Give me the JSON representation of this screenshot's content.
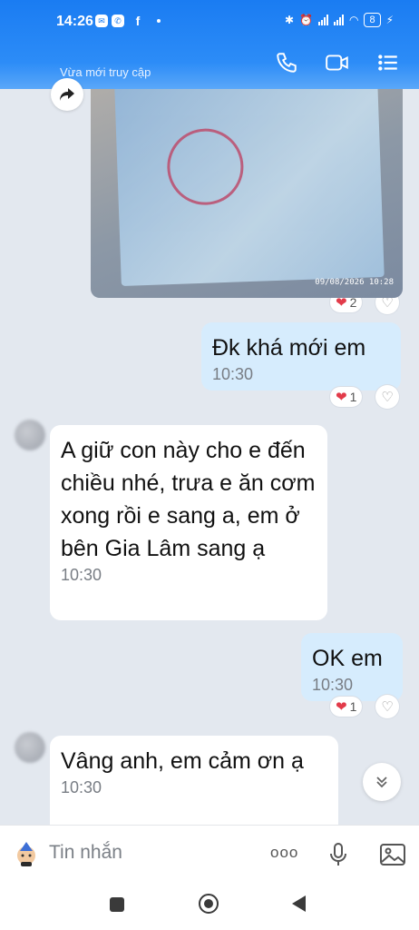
{
  "status_bar": {
    "time": "14:26",
    "battery": "8"
  },
  "header": {
    "subtitle": "Vừa mới truy cập"
  },
  "photo": {
    "timestamp": "09/08/2026 10:28"
  },
  "messages": [
    {
      "direction": "in",
      "type": "image",
      "reaction_count": "2"
    },
    {
      "direction": "out",
      "text": "Đk khá mới em",
      "time": "10:30",
      "reaction_count": "1"
    },
    {
      "direction": "in",
      "text": "A giữ con này cho e đến chiều nhé, trưa e ăn cơm xong rồi e sang a, em ở bên Gia Lâm sang ạ",
      "time": "10:30"
    },
    {
      "direction": "out",
      "text": "OK em",
      "time": "10:30",
      "reaction_count": "1"
    },
    {
      "direction": "in",
      "text": "Vâng anh, em cảm ơn ạ",
      "time": "10:30"
    }
  ],
  "composer": {
    "placeholder": "Tin nhắn",
    "more_label": "ooo"
  },
  "icons": {
    "phone": "phone-icon",
    "video": "video-icon",
    "menu": "list-menu-icon",
    "share": "share-icon",
    "heart": "heart-icon",
    "heart_outline": "heart-outline-icon",
    "chevron": "double-chevron-down-icon",
    "sticker": "sticker-icon",
    "mic": "microphone-icon",
    "image": "image-icon"
  },
  "colors": {
    "header": "#1a7cf2",
    "outgoing_bubble": "#d6ecfd",
    "incoming_bubble": "#ffffff",
    "background": "#e3e8ef",
    "heart": "#e23b4a"
  }
}
